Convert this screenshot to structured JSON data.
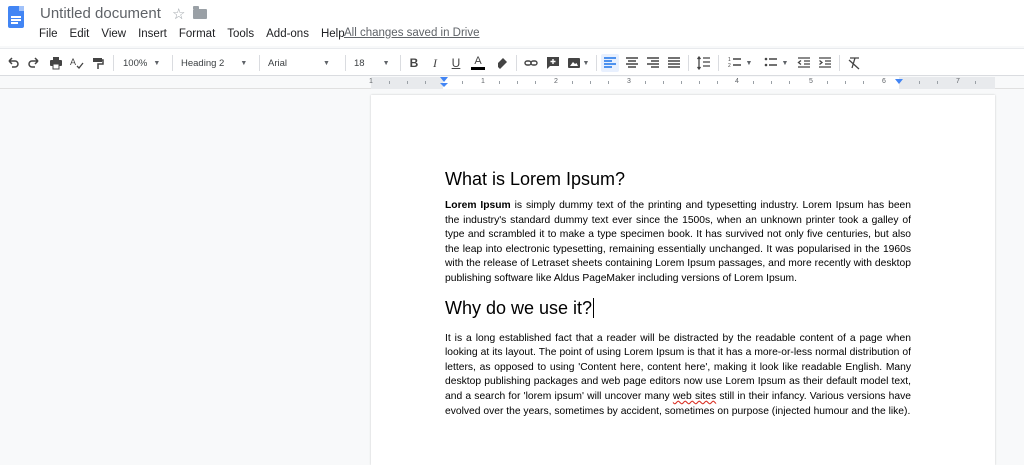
{
  "app": {
    "title": "Untitled document",
    "saved_status": "All changes saved in Drive",
    "menu": [
      "File",
      "Edit",
      "View",
      "Insert",
      "Format",
      "Tools",
      "Add-ons",
      "Help"
    ]
  },
  "toolbar": {
    "zoom": "100%",
    "style": "Heading 2",
    "font": "Arial",
    "size": "18"
  },
  "ruler": {
    "numbers": [
      "1",
      "1",
      "2",
      "3",
      "4",
      "5",
      "6",
      "7"
    ]
  },
  "document": {
    "heading1": "What is Lorem Ipsum?",
    "para1_bold": "Lorem Ipsum",
    "para1_rest": " is simply dummy text of the printing and typesetting industry. Lorem Ipsum has been the industry's standard dummy text ever since the 1500s, when an unknown printer took a galley of type and scrambled it to make a type specimen book. It has survived not only five centuries, but also the leap into electronic typesetting, remaining essentially unchanged. It was popularised in the 1960s with the release of Letraset sheets containing Lorem Ipsum passages, and more recently with desktop publishing software like Aldus PageMaker including versions of Lorem Ipsum.",
    "heading2": "Why do we use it?",
    "para2_a": "It is a long established fact that a reader will be distracted by the readable content of a page when looking at its layout. The point of using Lorem Ipsum is that it has a more-or-less normal distribution of letters, as opposed to using 'Content here, content here', making it look like readable English. Many desktop publishing packages and web page editors now use Lorem Ipsum as their default model text, and a search for 'lorem ipsum' will uncover many ",
    "para2_misspelled": "web sites",
    "para2_b": " still in their infancy. Various versions have evolved over the years, sometimes by accident, sometimes on purpose (injected humour and the like)."
  },
  "colors": {
    "accent": "#4285f4",
    "text_color_bar": "#000000"
  }
}
